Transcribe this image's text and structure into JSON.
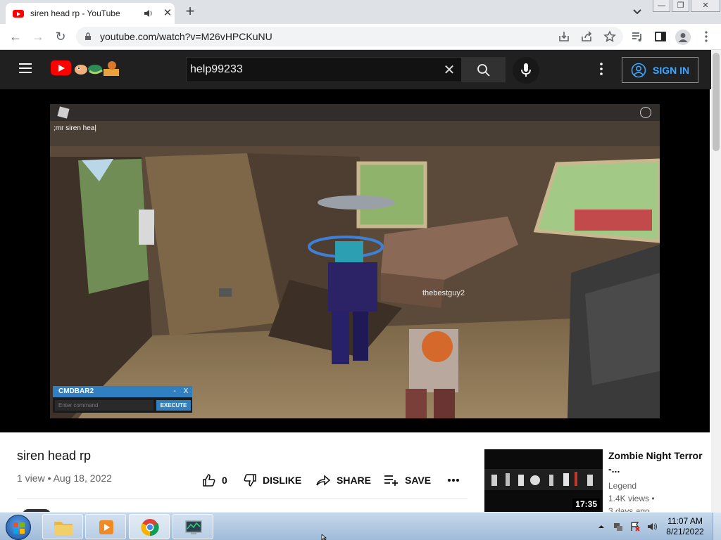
{
  "browser": {
    "tab_title": "siren head rp - YouTube",
    "url": "youtube.com/watch?v=M26vHPCKuNU"
  },
  "masthead": {
    "search_value": "help99233",
    "signin_label": "SIGN IN"
  },
  "video": {
    "chat_line": ";mr siren hea|",
    "player_nametag": "thebestguy2",
    "cmdbar_title": "CMDBAR2",
    "cmdbar_min": "-",
    "cmdbar_close": "X",
    "cmdbar_placeholder": "Enter command",
    "cmdbar_execute": "EXECUTE"
  },
  "info": {
    "title": "siren head rp",
    "meta": "1 view • Aug 18, 2022",
    "like_count": "0",
    "dislike_label": "DISLIKE",
    "share_label": "SHARE",
    "save_label": "SAVE"
  },
  "recommendation": {
    "title": "Zombie Night Terror -...",
    "channel": "Legend",
    "views": "1.4K views •",
    "date": "3 days ago",
    "duration": "17:35"
  },
  "taskbar": {
    "time": "11:07 AM",
    "date": "8/21/2022",
    "apps": [
      "explorer-icon",
      "media-player-icon",
      "chrome-icon",
      "task-manager-icon"
    ]
  },
  "colors": {
    "yt_red": "#ff0000",
    "signin_blue": "#3ea6ff",
    "masthead_bg": "#202020",
    "cmdbar_blue": "#2f7fc1"
  }
}
